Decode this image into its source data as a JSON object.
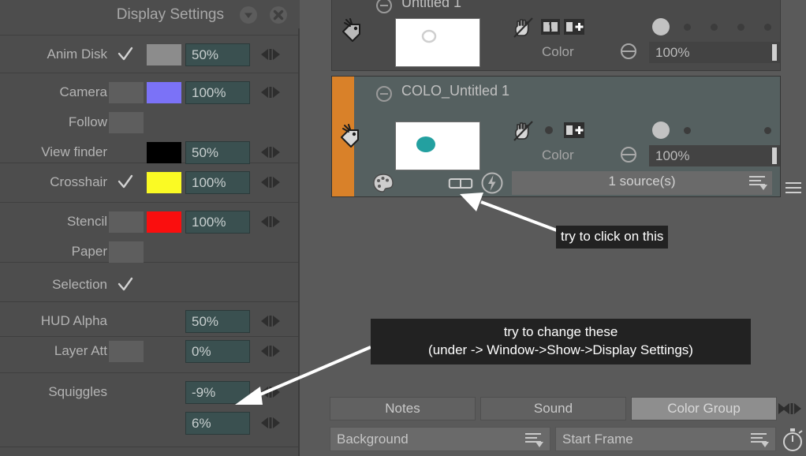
{
  "app": {
    "background": "#5a5a5a"
  },
  "display_settings": {
    "title": "Display Settings",
    "collapse_icon": "chevron-down-icon",
    "close_icon": "close-icon",
    "rows": [
      {
        "label": "Anim Disk",
        "checked": true,
        "swatch": "#8c8c8c",
        "value": "50%",
        "has_value": true,
        "has_swatch": true,
        "has_check": true,
        "arrows": true
      },
      {
        "label": "Camera",
        "checked": false,
        "swatch": "#7b72f7",
        "value": "100%",
        "has_value": true,
        "has_swatch": true,
        "has_check": true,
        "arrows": true
      },
      {
        "label": "Follow",
        "checked": false,
        "swatch": null,
        "value": null,
        "has_value": false,
        "has_swatch": false,
        "has_check": true,
        "arrows": false
      },
      {
        "label": "View finder",
        "checked": false,
        "swatch": "#000000",
        "value": "50%",
        "has_value": true,
        "has_swatch": true,
        "has_check": false,
        "arrows": true
      },
      {
        "label": "Crosshair",
        "checked": true,
        "swatch": "#fafa24",
        "value": "100%",
        "has_value": true,
        "has_swatch": true,
        "has_check": true,
        "arrows": true
      },
      {
        "label": "Stencil",
        "checked": false,
        "swatch": "#fa0e0e",
        "value": "100%",
        "has_value": true,
        "has_swatch": true,
        "has_check": true,
        "arrows": true
      },
      {
        "label": "Paper",
        "checked": false,
        "swatch": null,
        "value": null,
        "has_value": false,
        "has_swatch": false,
        "has_check": true,
        "arrows": false
      },
      {
        "label": "Selection",
        "checked": true,
        "swatch": null,
        "value": null,
        "has_value": false,
        "has_swatch": false,
        "has_check": true,
        "arrows": false
      },
      {
        "label": "HUD Alpha",
        "checked": false,
        "swatch": null,
        "value": "50%",
        "has_value": true,
        "has_swatch": false,
        "has_check": false,
        "arrows": true
      },
      {
        "label": "Layer Att",
        "checked": false,
        "swatch": null,
        "value": "0%",
        "has_value": true,
        "has_swatch": false,
        "has_check": true,
        "arrows": true
      },
      {
        "label": "Squiggles",
        "checked": false,
        "swatch": null,
        "value": "-9%",
        "has_value": true,
        "has_swatch": false,
        "has_check": false,
        "arrows": true
      },
      {
        "label": "",
        "checked": false,
        "swatch": null,
        "value": "6%",
        "has_value": true,
        "has_swatch": false,
        "has_check": false,
        "arrows": true
      }
    ]
  },
  "xsheet": {
    "cell_top": {
      "title": "Untitled 1",
      "collapse_icon": "minus-circle-icon",
      "tag_icon": "tag-hand-icon",
      "thumb_icon": "ring-shape-icon",
      "hand_icon": "hand-lock-icon",
      "swap_icon": "swap-icon",
      "add_icon": "add-column-icon",
      "color_label": "Color",
      "filter_icon": "filter-circle-icon",
      "opacity": "100%",
      "dots": 5,
      "active_dot": 0
    },
    "cell_selected": {
      "title": "COLO_Untitled 1",
      "collapse_icon": "minus-circle-icon",
      "tag_icon": "tag-hand-icon",
      "thumb_icon": "teal-dot-icon",
      "hand_icon": "hand-lock-icon",
      "add_icon": "add-column-icon",
      "color_label": "Color",
      "filter_icon": "filter-circle-icon",
      "opacity": "100%",
      "dots": 3,
      "active_dot": 0,
      "palette_icon": "palette-icon",
      "glasses_icon": "glasses-icon",
      "flash_icon": "flash-circle-icon",
      "sources": "1 source(s)",
      "list_icon": "list-dropdown-icon"
    },
    "options_icon": "hamburger-icon"
  },
  "annotations": [
    {
      "text": "try to click on this",
      "align": "left"
    },
    {
      "text": "try to change these\n(under -> Window->Show->Display Settings)",
      "align": "center"
    }
  ],
  "bottom": {
    "tabs": [
      {
        "label": "Notes",
        "active": false
      },
      {
        "label": "Sound",
        "active": false
      },
      {
        "label": "Color Group",
        "active": true
      }
    ],
    "tab_arrows_icon": "left-right-arrows-icon",
    "combos": [
      {
        "label": "Background",
        "icon": "list-dropdown-icon"
      },
      {
        "label": "Start Frame",
        "icon": "list-dropdown-icon"
      }
    ],
    "stopwatch_icon": "stopwatch-icon"
  }
}
